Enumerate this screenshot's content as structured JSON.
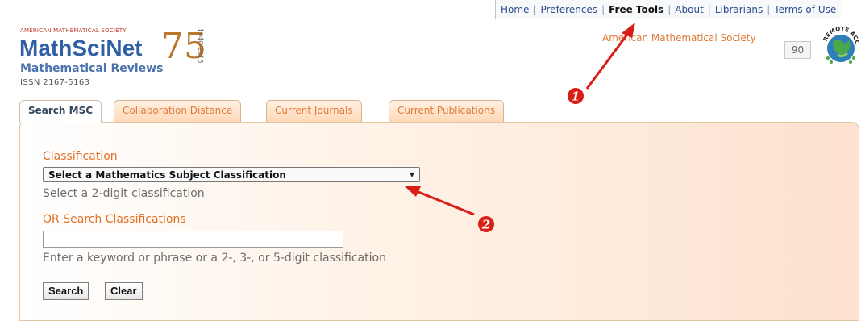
{
  "top_nav": {
    "items": [
      "Home",
      "Preferences",
      "Free Tools",
      "About",
      "Librarians",
      "Terms of Use"
    ],
    "active_index": 2
  },
  "logo": {
    "tagline": "AMERICAN MATHEMATICAL SOCIETY",
    "name": "MathSciNet",
    "subtitle": "Mathematical Reviews",
    "anniversary": "75",
    "years": "1940-2015"
  },
  "issn": "ISSN 2167-5163",
  "org_name": "American Mathematical Society",
  "remote_counter": "90",
  "remote_access_badge": "REMOTE ACCESS",
  "tabs": [
    {
      "label": "Search MSC",
      "active": true
    },
    {
      "label": "Collaboration Distance",
      "active": false
    },
    {
      "label": "Current Journals",
      "active": false
    },
    {
      "label": "Current Publications",
      "active": false
    }
  ],
  "form": {
    "classification_label": "Classification",
    "select_value": "Select a Mathematics Subject Classification",
    "classification_hint": "Select a 2-digit classification",
    "search_label": "OR Search Classifications",
    "search_value": "",
    "search_hint": "Enter a keyword or phrase or a 2-, 3-, or 5-digit classification",
    "search_button": "Search",
    "clear_button": "Clear"
  },
  "annotations": [
    "1",
    "2"
  ],
  "colors": {
    "accent_orange": "#e16f26",
    "brand_blue": "#2f5fa4",
    "annotation_red": "#d91e18"
  }
}
